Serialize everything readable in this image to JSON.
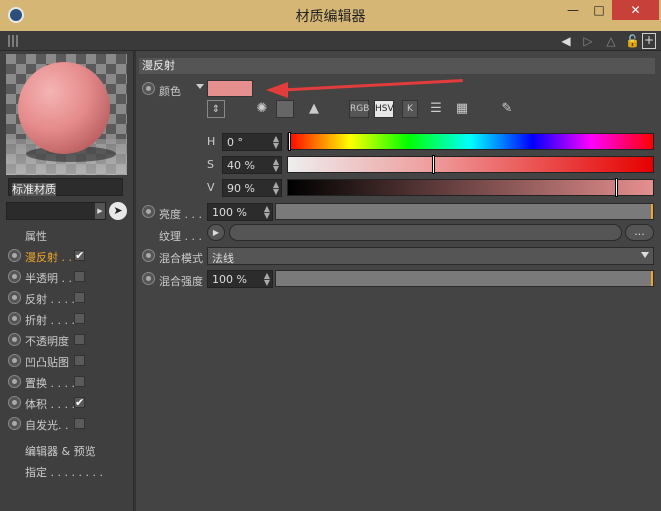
{
  "window": {
    "title": "材质编辑器",
    "minimize": "—",
    "maximize": "□",
    "close": "✕"
  },
  "toolbar": {
    "icons": [
      "arrow-left-icon",
      "arrow-right-icon",
      "lock-icon",
      "new-window-icon"
    ]
  },
  "material": {
    "name": "标准材质",
    "preview_color": "#e68f8f"
  },
  "left_panel": {
    "properties_heading": "属性",
    "channels": [
      {
        "label": "漫反射 . .",
        "checked": true,
        "active": true
      },
      {
        "label": "半透明 . .",
        "checked": false,
        "active": false
      },
      {
        "label": "反射 . . . .",
        "checked": false,
        "active": false
      },
      {
        "label": "折射 . . . .",
        "checked": false,
        "active": false
      },
      {
        "label": "不透明度",
        "checked": false,
        "active": false
      },
      {
        "label": "凹凸贴图",
        "checked": false,
        "active": false
      },
      {
        "label": "置换 . . . .",
        "checked": false,
        "active": false
      },
      {
        "label": "体积 . . . .",
        "checked": true,
        "active": false
      },
      {
        "label": "自发光. .",
        "checked": false,
        "active": false
      }
    ],
    "footer": [
      "编辑器 & 预览",
      "指定 . . . . . . . ."
    ]
  },
  "diffuse": {
    "section_title": "漫反射",
    "color_label": "颜色",
    "color_value": "#e68f8f",
    "modes": [
      "RGB",
      "HSV",
      "K"
    ],
    "active_mode": "HSV",
    "hsv": [
      {
        "letter": "H",
        "value": "0 °",
        "fraction": 0.0
      },
      {
        "letter": "S",
        "value": "40 %",
        "fraction": 0.4
      },
      {
        "letter": "V",
        "value": "90 %",
        "fraction": 0.9
      }
    ],
    "brightness_label": "亮度 . . .",
    "brightness_value": "100 %",
    "texture_label": "纹理 . . .",
    "texture_more": "...",
    "blend_mode_label": "混合模式",
    "blend_mode_value": "法线",
    "blend_strength_label": "混合强度",
    "blend_strength_value": "100 %"
  },
  "colors": {
    "accent": "#f0a52a",
    "titlebar": "#d6b675",
    "close_button": "#c7413a",
    "annotation_arrow": "#e23c3c"
  }
}
